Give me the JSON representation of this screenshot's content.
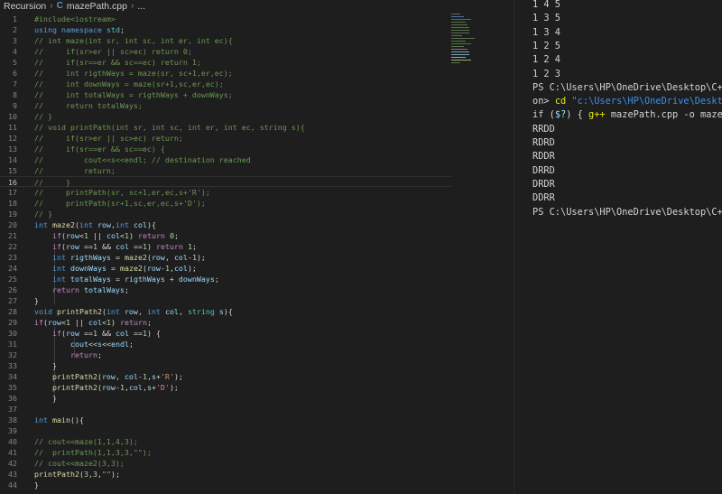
{
  "breadcrumb": {
    "folder": "Recursion",
    "file_icon": "C",
    "file": "mazePath.cpp",
    "more": "..."
  },
  "editor": {
    "current_line": 16,
    "lines": [
      [
        [
          "c",
          "#include<iostream>"
        ]
      ],
      [
        [
          "k",
          "using"
        ],
        [
          "p",
          " "
        ],
        [
          "k",
          "namespace"
        ],
        [
          "p",
          " "
        ],
        [
          "t",
          "std"
        ],
        [
          "p",
          ";"
        ]
      ],
      [
        [
          "c",
          "// int maze(int sr, int sc, int er, int ec){"
        ]
      ],
      [
        [
          "c",
          "//     if(sr>er || sc>ec) return 0;"
        ]
      ],
      [
        [
          "c",
          "//     if(sr==er && sc==ec) return 1;"
        ]
      ],
      [
        [
          "c",
          "//     int rigthWays = maze(sr, sc+1,er,ec);"
        ]
      ],
      [
        [
          "c",
          "//     int downWays = maze(sr+1,sc,er,ec);"
        ]
      ],
      [
        [
          "c",
          "//     int totalWays = rigthWays + downWays;"
        ]
      ],
      [
        [
          "c",
          "//     return totalWays;"
        ]
      ],
      [
        [
          "c",
          "// }"
        ]
      ],
      [
        [
          "c",
          "// void printPath(int sr, int sc, int er, int ec, string s){"
        ]
      ],
      [
        [
          "c",
          "//     if(sr>er || sc>ec) return;"
        ]
      ],
      [
        [
          "c",
          "//     if(sr==er && sc==ec) {"
        ]
      ],
      [
        [
          "c",
          "//         cout<<s<<endl; // destination reached"
        ]
      ],
      [
        [
          "c",
          "//         return;"
        ]
      ],
      [
        [
          "c",
          "//     }"
        ]
      ],
      [
        [
          "c",
          "//     printPath(sr, sc+1,er,ec,s+'R');"
        ]
      ],
      [
        [
          "c",
          "//     printPath(sr+1,sc,er,ec,s+'D');"
        ]
      ],
      [
        [
          "c",
          "// }"
        ]
      ],
      [
        [
          "k",
          "int"
        ],
        [
          "p",
          " "
        ],
        [
          "f",
          "maze2"
        ],
        [
          "p",
          "("
        ],
        [
          "k",
          "int"
        ],
        [
          "p",
          " "
        ],
        [
          "v",
          "row"
        ],
        [
          "p",
          ","
        ],
        [
          "k",
          "int"
        ],
        [
          "p",
          " "
        ],
        [
          "v",
          "col"
        ],
        [
          "p",
          "){"
        ]
      ],
      [
        [
          "p",
          "    "
        ],
        [
          "kc",
          "if"
        ],
        [
          "p",
          "("
        ],
        [
          "v",
          "row"
        ],
        [
          "p",
          "<"
        ],
        [
          "n",
          "1"
        ],
        [
          "p",
          " || "
        ],
        [
          "v",
          "col"
        ],
        [
          "p",
          "<"
        ],
        [
          "n",
          "1"
        ],
        [
          "p",
          ") "
        ],
        [
          "kc",
          "return"
        ],
        [
          "p",
          " "
        ],
        [
          "n",
          "0"
        ],
        [
          "p",
          ";"
        ]
      ],
      [
        [
          "p",
          "    "
        ],
        [
          "kc",
          "if"
        ],
        [
          "p",
          "("
        ],
        [
          "v",
          "row"
        ],
        [
          "p",
          " =="
        ],
        [
          "n",
          "1"
        ],
        [
          "p",
          " && "
        ],
        [
          "v",
          "col"
        ],
        [
          "p",
          " =="
        ],
        [
          "n",
          "1"
        ],
        [
          "p",
          ") "
        ],
        [
          "kc",
          "return"
        ],
        [
          "p",
          " "
        ],
        [
          "n",
          "1"
        ],
        [
          "p",
          ";"
        ]
      ],
      [
        [
          "p",
          "    "
        ],
        [
          "k",
          "int"
        ],
        [
          "p",
          " "
        ],
        [
          "v",
          "rigthWays"
        ],
        [
          "p",
          " = "
        ],
        [
          "f",
          "maze2"
        ],
        [
          "p",
          "("
        ],
        [
          "v",
          "row"
        ],
        [
          "p",
          ", "
        ],
        [
          "v",
          "col"
        ],
        [
          "p",
          "-"
        ],
        [
          "n",
          "1"
        ],
        [
          "p",
          ");"
        ]
      ],
      [
        [
          "p",
          "    "
        ],
        [
          "k",
          "int"
        ],
        [
          "p",
          " "
        ],
        [
          "v",
          "downWays"
        ],
        [
          "p",
          " = "
        ],
        [
          "f",
          "maze2"
        ],
        [
          "p",
          "("
        ],
        [
          "v",
          "row"
        ],
        [
          "p",
          "-"
        ],
        [
          "n",
          "1"
        ],
        [
          "p",
          ","
        ],
        [
          "v",
          "col"
        ],
        [
          "p",
          ");"
        ]
      ],
      [
        [
          "p",
          "    "
        ],
        [
          "k",
          "int"
        ],
        [
          "p",
          " "
        ],
        [
          "v",
          "totalWays"
        ],
        [
          "p",
          " = "
        ],
        [
          "v",
          "rigthWays"
        ],
        [
          "p",
          " + "
        ],
        [
          "v",
          "downWays"
        ],
        [
          "p",
          ";"
        ]
      ],
      [
        [
          "p",
          "    "
        ],
        [
          "kc",
          "return"
        ],
        [
          "p",
          " "
        ],
        [
          "v",
          "totalWays"
        ],
        [
          "p",
          ";"
        ]
      ],
      [
        [
          "p",
          "}"
        ]
      ],
      [
        [
          "k",
          "void"
        ],
        [
          "p",
          " "
        ],
        [
          "f",
          "printPath2"
        ],
        [
          "p",
          "("
        ],
        [
          "k",
          "int"
        ],
        [
          "p",
          " "
        ],
        [
          "v",
          "row"
        ],
        [
          "p",
          ", "
        ],
        [
          "k",
          "int"
        ],
        [
          "p",
          " "
        ],
        [
          "v",
          "col"
        ],
        [
          "p",
          ", "
        ],
        [
          "t",
          "string"
        ],
        [
          "p",
          " "
        ],
        [
          "v",
          "s"
        ],
        [
          "p",
          "){"
        ]
      ],
      [
        [
          "kc",
          "if"
        ],
        [
          "p",
          "("
        ],
        [
          "v",
          "row"
        ],
        [
          "p",
          "<"
        ],
        [
          "n",
          "1"
        ],
        [
          "p",
          " || "
        ],
        [
          "v",
          "col"
        ],
        [
          "p",
          "<"
        ],
        [
          "n",
          "1"
        ],
        [
          "p",
          ") "
        ],
        [
          "kc",
          "return"
        ],
        [
          "p",
          ";"
        ]
      ],
      [
        [
          "p",
          "    "
        ],
        [
          "kc",
          "if"
        ],
        [
          "p",
          "("
        ],
        [
          "v",
          "row"
        ],
        [
          "p",
          " =="
        ],
        [
          "n",
          "1"
        ],
        [
          "p",
          " && "
        ],
        [
          "v",
          "col"
        ],
        [
          "p",
          " =="
        ],
        [
          "n",
          "1"
        ],
        [
          "p",
          ") {"
        ]
      ],
      [
        [
          "p",
          "        "
        ],
        [
          "v",
          "cout"
        ],
        [
          "p",
          "<<"
        ],
        [
          "v",
          "s"
        ],
        [
          "p",
          "<<"
        ],
        [
          "v",
          "endl"
        ],
        [
          "p",
          ";"
        ]
      ],
      [
        [
          "p",
          "        "
        ],
        [
          "kc",
          "return"
        ],
        [
          "p",
          ";"
        ]
      ],
      [
        [
          "p",
          "    }"
        ]
      ],
      [
        [
          "p",
          "    "
        ],
        [
          "f",
          "printPath2"
        ],
        [
          "p",
          "("
        ],
        [
          "v",
          "row"
        ],
        [
          "p",
          ", "
        ],
        [
          "v",
          "col"
        ],
        [
          "p",
          "-"
        ],
        [
          "n",
          "1"
        ],
        [
          "p",
          ","
        ],
        [
          "v",
          "s"
        ],
        [
          "p",
          "+"
        ],
        [
          "s",
          "'R'"
        ],
        [
          "p",
          ");"
        ]
      ],
      [
        [
          "p",
          "    "
        ],
        [
          "f",
          "printPath2"
        ],
        [
          "p",
          "("
        ],
        [
          "v",
          "row"
        ],
        [
          "p",
          "-"
        ],
        [
          "n",
          "1"
        ],
        [
          "p",
          ","
        ],
        [
          "v",
          "col"
        ],
        [
          "p",
          ","
        ],
        [
          "v",
          "s"
        ],
        [
          "p",
          "+"
        ],
        [
          "s",
          "'D'"
        ],
        [
          "p",
          ");"
        ]
      ],
      [
        [
          "p",
          "    }"
        ]
      ],
      [],
      [
        [
          "k",
          "int"
        ],
        [
          "p",
          " "
        ],
        [
          "f",
          "main"
        ],
        [
          "p",
          "(){"
        ]
      ],
      [],
      [
        [
          "c",
          "// cout<<maze(1,1,4,3);"
        ]
      ],
      [
        [
          "c",
          "//  printPath(1,1,3,3,\"\");"
        ]
      ],
      [
        [
          "c",
          "// cout<<maze2(3,3);"
        ]
      ],
      [
        [
          "f",
          "printPath2"
        ],
        [
          "p",
          "("
        ],
        [
          "n",
          "3"
        ],
        [
          "p",
          ","
        ],
        [
          "n",
          "3"
        ],
        [
          "p",
          ","
        ],
        [
          "s",
          "\"\""
        ],
        [
          "p",
          ");"
        ]
      ],
      [
        [
          "p",
          "}"
        ]
      ]
    ]
  },
  "terminal": {
    "lines": [
      [
        [
          "p",
          "1 4 5"
        ]
      ],
      [
        [
          "p",
          "1 3 5"
        ]
      ],
      [
        [
          "p",
          "1 3 4"
        ]
      ],
      [
        [
          "p",
          "1 2 5"
        ]
      ],
      [
        [
          "p",
          "1 2 4"
        ]
      ],
      [
        [
          "p",
          "1 2 3"
        ]
      ],
      [
        [
          "p",
          "PS C:\\Users\\HP\\OneDrive\\Desktop\\C++ w"
        ]
      ],
      [
        [
          "p",
          "on> "
        ],
        [
          "yl",
          "cd"
        ],
        [
          "p",
          " "
        ],
        [
          "cy",
          "\"c:\\Users\\HP\\OneDrive\\Desktop\\"
        ]
      ],
      [
        [
          "p",
          "if ("
        ],
        [
          "v",
          "$?"
        ],
        [
          "p",
          ") { "
        ],
        [
          "yl",
          "g++"
        ],
        [
          "p",
          " mazePath.cpp -o mazePat"
        ]
      ],
      [
        [
          "p",
          "RRDD"
        ]
      ],
      [
        [
          "p",
          "RDRD"
        ]
      ],
      [
        [
          "p",
          "RDDR"
        ]
      ],
      [
        [
          "p",
          "DRRD"
        ]
      ],
      [
        [
          "p",
          "DRDR"
        ]
      ],
      [
        [
          "p",
          "DDRR"
        ]
      ],
      [
        [
          "p",
          "PS C:\\Users\\HP\\OneDrive\\Desktop\\C++ w"
        ]
      ]
    ]
  }
}
